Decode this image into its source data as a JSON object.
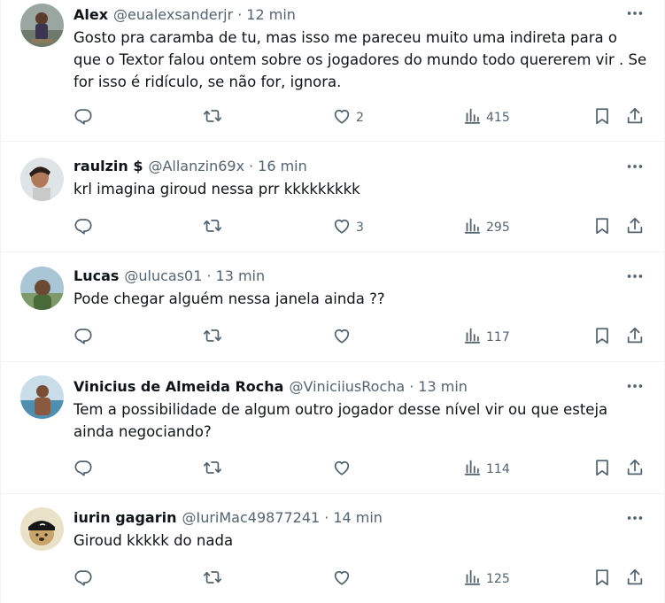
{
  "tweets": [
    {
      "name": "Alex",
      "handle": "@eualexsanderjr",
      "sep": "·",
      "time": "12 min",
      "text": "Gosto pra caramba de tu, mas isso me pareceu muito uma indireta para o que o Textor falou ontem sobre os jogadores do mundo todo quererem vir . Se for isso é ridículo, se não for, ignora.",
      "likes": "2",
      "views": "415"
    },
    {
      "name": "raulzin $",
      "handle": "@Allanzin69x",
      "sep": "·",
      "time": "16 min",
      "text": "krl imagina giroud nessa prr kkkkkkkkk",
      "likes": "3",
      "views": "295"
    },
    {
      "name": "Lucas",
      "handle": "@ulucas01",
      "sep": "·",
      "time": "13 min",
      "text": "Pode chegar alguém nessa janela ainda ??",
      "likes": "",
      "views": "117"
    },
    {
      "name": "Vinicius de Almeida Rocha",
      "handle": "@ViniciiusRocha",
      "sep": "·",
      "time": "13 min",
      "text": "Tem a possibilidade de algum outro jogador desse nível vir ou que esteja ainda negociando?",
      "likes": "",
      "views": "114"
    },
    {
      "name": "iurin gagarin",
      "handle": "@IuriMac49877241",
      "sep": "·",
      "time": "14 min",
      "text": "Giroud kkkkk do nada",
      "likes": "",
      "views": "125"
    }
  ],
  "icons": {
    "reply": "reply-icon",
    "retweet": "retweet-icon",
    "like": "heart-icon",
    "views": "views-icon",
    "bookmark": "bookmark-icon",
    "share": "share-icon",
    "more": "more-icon"
  },
  "colors": {
    "text": "#0f1419",
    "secondary": "#536471",
    "border": "#eff3f4"
  }
}
